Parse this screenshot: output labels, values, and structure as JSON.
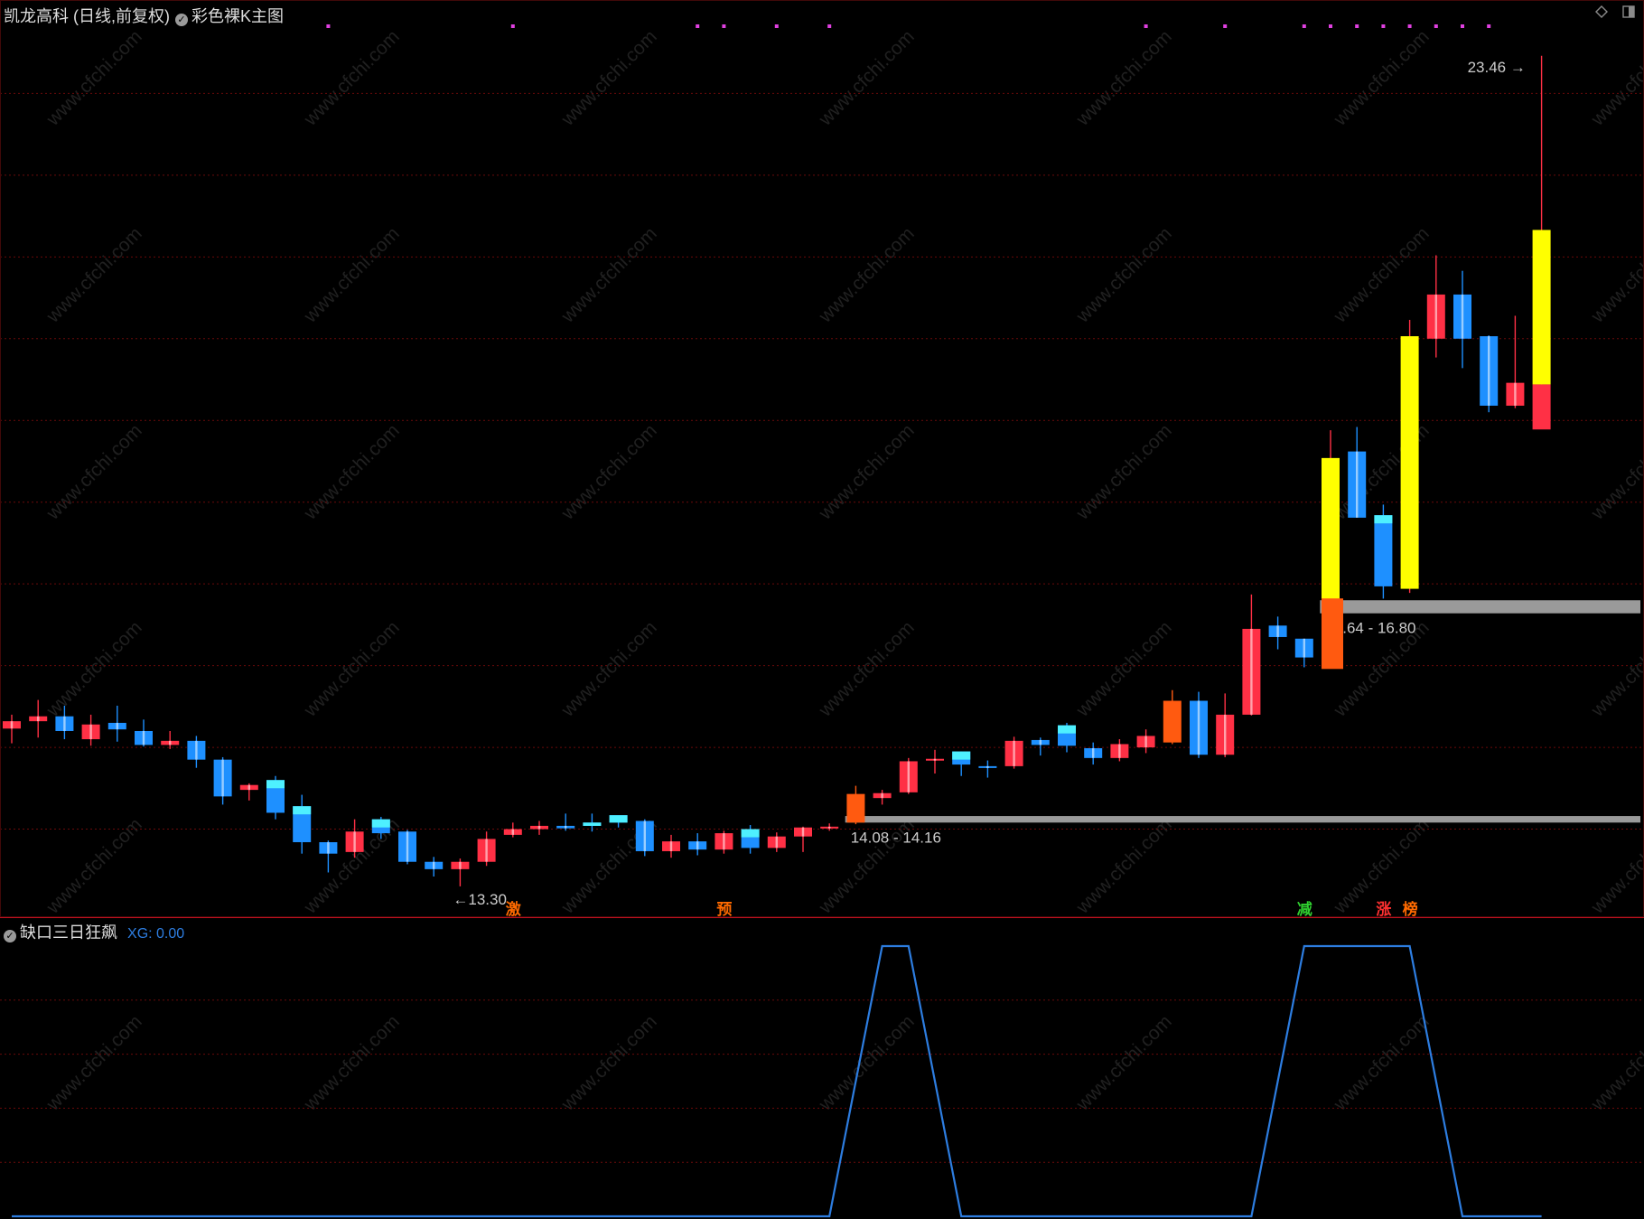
{
  "header": {
    "stock": "凯龙高科 (日线,前复权)",
    "indicator": "彩色裸K主图"
  },
  "sub_header": {
    "indicator": "缺口三日狂飙",
    "xg_text": "XG: 0.00"
  },
  "colors": {
    "background": "#000000",
    "up": "#ff3045",
    "down": "#1e90ff",
    "cyan": "#4ef0ff",
    "yellow": "#ffff00",
    "orange": "#ff5a10",
    "gap_band": "#9a9a9a",
    "grid": "#6a0a0a",
    "separator": "#c01020",
    "xg_line": "#2d7de0",
    "dots": "#e040e0"
  },
  "watermark": "www.cfchi.com",
  "signals": [
    {
      "label": "激",
      "color": "#ff6a00"
    },
    {
      "label": "预",
      "color": "#ff6a00"
    },
    {
      "label": "减",
      "color": "#30d030"
    },
    {
      "label": "涨",
      "color": "#ff3030"
    },
    {
      "label": "榜",
      "color": "#ff6a00"
    }
  ],
  "chart_data": [
    {
      "type": "candlestick",
      "price_range": [
        13.0,
        23.9
      ],
      "high_label": "23.46",
      "low_label": "13.30",
      "gaps": [
        {
          "label": "14.08 - 14.16",
          "low": 14.08,
          "high": 14.16
        },
        {
          "label": "16.64 - 16.80",
          "low": 16.64,
          "high": 16.8
        }
      ],
      "candles": [
        {
          "o": 15.23,
          "h": 15.4,
          "l": 15.05,
          "c": 15.32,
          "color": "up"
        },
        {
          "o": 15.32,
          "h": 15.58,
          "l": 15.12,
          "c": 15.38,
          "color": "up"
        },
        {
          "o": 15.38,
          "h": 15.51,
          "l": 15.1,
          "c": 15.2,
          "color": "down"
        },
        {
          "o": 15.28,
          "h": 15.4,
          "l": 15.02,
          "c": 15.1,
          "color": "up"
        },
        {
          "o": 15.3,
          "h": 15.51,
          "l": 15.07,
          "c": 15.22,
          "color": "down"
        },
        {
          "o": 15.2,
          "h": 15.34,
          "l": 15.01,
          "c": 15.03,
          "color": "down"
        },
        {
          "o": 15.03,
          "h": 15.2,
          "l": 14.98,
          "c": 15.08,
          "color": "up"
        },
        {
          "o": 15.08,
          "h": 15.14,
          "l": 14.75,
          "c": 14.85,
          "color": "down"
        },
        {
          "o": 14.85,
          "h": 14.88,
          "l": 14.3,
          "c": 14.4,
          "color": "down"
        },
        {
          "o": 14.48,
          "h": 14.56,
          "l": 14.35,
          "c": 14.54,
          "color": "up"
        },
        {
          "o": 14.6,
          "h": 14.65,
          "l": 14.12,
          "c": 14.2,
          "color": "cyan-down"
        },
        {
          "o": 14.28,
          "h": 14.42,
          "l": 13.7,
          "c": 13.84,
          "color": "cyan-down"
        },
        {
          "o": 13.84,
          "h": 13.86,
          "l": 13.47,
          "c": 13.7,
          "color": "down"
        },
        {
          "o": 13.72,
          "h": 14.12,
          "l": 13.65,
          "c": 13.97,
          "color": "up"
        },
        {
          "o": 14.12,
          "h": 14.15,
          "l": 13.88,
          "c": 13.95,
          "color": "cyan-down"
        },
        {
          "o": 13.97,
          "h": 13.99,
          "l": 13.57,
          "c": 13.6,
          "color": "down"
        },
        {
          "o": 13.6,
          "h": 13.66,
          "l": 13.42,
          "c": 13.51,
          "color": "down"
        },
        {
          "o": 13.51,
          "h": 13.64,
          "l": 13.3,
          "c": 13.6,
          "color": "up"
        },
        {
          "o": 13.6,
          "h": 13.97,
          "l": 13.55,
          "c": 13.88,
          "color": "up"
        },
        {
          "o": 13.93,
          "h": 14.08,
          "l": 13.9,
          "c": 14.0,
          "color": "up"
        },
        {
          "o": 14.0,
          "h": 14.1,
          "l": 13.93,
          "c": 14.04,
          "color": "up"
        },
        {
          "o": 14.04,
          "h": 14.19,
          "l": 13.98,
          "c": 14.01,
          "color": "down"
        },
        {
          "o": 14.04,
          "h": 14.19,
          "l": 13.97,
          "c": 14.08,
          "color": "cyan-up"
        },
        {
          "o": 14.08,
          "h": 14.13,
          "l": 14.02,
          "c": 14.17,
          "color": "cyan-up"
        },
        {
          "o": 14.1,
          "h": 14.12,
          "l": 13.67,
          "c": 13.73,
          "color": "down"
        },
        {
          "o": 13.73,
          "h": 13.93,
          "l": 13.65,
          "c": 13.85,
          "color": "up"
        },
        {
          "o": 13.85,
          "h": 13.95,
          "l": 13.68,
          "c": 13.75,
          "color": "down"
        },
        {
          "o": 13.75,
          "h": 13.98,
          "l": 13.7,
          "c": 13.95,
          "color": "up"
        },
        {
          "o": 14.0,
          "h": 14.05,
          "l": 13.7,
          "c": 13.77,
          "color": "cyan-down"
        },
        {
          "o": 13.77,
          "h": 13.96,
          "l": 13.72,
          "c": 13.91,
          "color": "up"
        },
        {
          "o": 13.91,
          "h": 14.03,
          "l": 13.72,
          "c": 14.02,
          "color": "up"
        },
        {
          "o": 14.02,
          "h": 14.07,
          "l": 13.98,
          "c": 14.03,
          "color": "up"
        },
        {
          "o": 14.08,
          "h": 14.53,
          "l": 14.06,
          "c": 14.43,
          "color": "orange"
        },
        {
          "o": 14.38,
          "h": 14.48,
          "l": 14.3,
          "c": 14.44,
          "color": "up"
        },
        {
          "o": 14.45,
          "h": 14.87,
          "l": 14.43,
          "c": 14.83,
          "color": "up"
        },
        {
          "o": 14.86,
          "h": 14.97,
          "l": 14.68,
          "c": 14.84,
          "color": "up"
        },
        {
          "o": 14.95,
          "h": 14.95,
          "l": 14.65,
          "c": 14.79,
          "color": "cyan-down"
        },
        {
          "o": 14.77,
          "h": 14.84,
          "l": 14.63,
          "c": 14.77,
          "color": "down"
        },
        {
          "o": 14.77,
          "h": 15.13,
          "l": 14.74,
          "c": 15.08,
          "color": "up"
        },
        {
          "o": 15.09,
          "h": 15.12,
          "l": 14.9,
          "c": 15.03,
          "color": "down"
        },
        {
          "o": 15.27,
          "h": 15.3,
          "l": 14.94,
          "c": 15.02,
          "color": "cyan-down"
        },
        {
          "o": 14.99,
          "h": 15.06,
          "l": 14.79,
          "c": 14.87,
          "color": "down"
        },
        {
          "o": 14.87,
          "h": 15.1,
          "l": 14.83,
          "c": 15.04,
          "color": "up"
        },
        {
          "o": 15.0,
          "h": 15.22,
          "l": 14.93,
          "c": 15.14,
          "color": "up"
        },
        {
          "o": 15.06,
          "h": 15.7,
          "l": 15.04,
          "c": 15.57,
          "color": "orange"
        },
        {
          "o": 15.57,
          "h": 15.68,
          "l": 14.87,
          "c": 14.91,
          "color": "down"
        },
        {
          "o": 14.91,
          "h": 15.66,
          "l": 14.88,
          "c": 15.4,
          "color": "up"
        },
        {
          "o": 15.4,
          "h": 16.87,
          "l": 15.39,
          "c": 16.45,
          "color": "up"
        },
        {
          "o": 16.49,
          "h": 16.6,
          "l": 16.2,
          "c": 16.35,
          "color": "down"
        },
        {
          "o": 16.33,
          "h": 16.32,
          "l": 15.98,
          "c": 16.1,
          "color": "down"
        },
        {
          "o": 16.07,
          "h": 18.88,
          "l": 16.07,
          "c": 18.54,
          "color": "yellow"
        },
        {
          "o": 18.62,
          "h": 18.92,
          "l": 17.84,
          "c": 17.81,
          "color": "down"
        },
        {
          "o": 17.84,
          "h": 17.97,
          "l": 16.82,
          "c": 16.97,
          "color": "cyan-down"
        },
        {
          "o": 16.94,
          "h": 20.23,
          "l": 16.89,
          "c": 20.03,
          "color": "yellow"
        },
        {
          "o": 20.0,
          "h": 21.02,
          "l": 19.77,
          "c": 20.54,
          "color": "up"
        },
        {
          "o": 20.54,
          "h": 20.83,
          "l": 19.64,
          "c": 20.0,
          "color": "down"
        },
        {
          "o": 20.03,
          "h": 20.04,
          "l": 19.1,
          "c": 19.18,
          "color": "down"
        },
        {
          "o": 19.18,
          "h": 20.28,
          "l": 19.15,
          "c": 19.46,
          "color": "up"
        },
        {
          "o": 19.44,
          "h": 23.46,
          "l": 19.42,
          "c": 21.33,
          "color": "yellow"
        }
      ]
    },
    {
      "type": "line",
      "name": "XG",
      "y_range": [
        0,
        1
      ],
      "values": [
        0,
        0,
        0,
        0,
        0,
        0,
        0,
        0,
        0,
        0,
        0,
        0,
        0,
        0,
        0,
        0,
        0,
        0,
        0,
        0,
        0,
        0,
        0,
        0,
        0,
        0,
        0,
        0,
        0,
        0,
        0,
        0,
        0.5,
        1,
        1,
        0.5,
        0,
        0,
        0,
        0,
        0,
        0,
        0,
        0,
        0,
        0,
        0,
        0,
        0.5,
        1,
        1,
        1,
        1,
        1,
        0.5,
        0,
        0,
        0,
        0
      ]
    }
  ]
}
